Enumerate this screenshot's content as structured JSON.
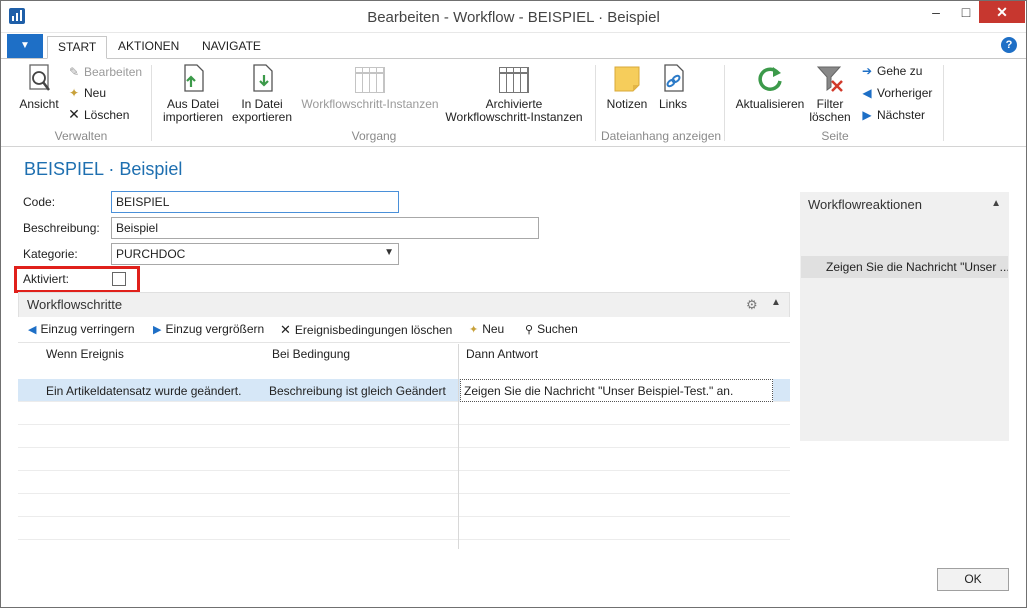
{
  "window": {
    "title": "Bearbeiten - Workflow - BEISPIEL · Beispiel",
    "minimize": "–",
    "maximize": "□",
    "close": "✕"
  },
  "tabs": [
    {
      "label": "START",
      "active": true
    },
    {
      "label": "AKTIONEN",
      "active": false
    },
    {
      "label": "NAVIGATE",
      "active": false
    }
  ],
  "ribbon": {
    "verwalten": {
      "group_label": "Verwalten",
      "ansicht": "Ansicht",
      "bearbeiten": "Bearbeiten",
      "neu": "Neu",
      "loeschen": "Löschen"
    },
    "vorgang": {
      "group_label": "Vorgang",
      "aus_datei_1": "Aus Datei",
      "aus_datei_2": "importieren",
      "in_datei_1": "In Datei",
      "in_datei_2": "exportieren",
      "instanzen": "Workflowschritt-Instanzen",
      "archiv_1": "Archivierte",
      "archiv_2": "Workflowschritt-Instanzen"
    },
    "dateianhang": {
      "group_label": "Dateianhang anzeigen",
      "notizen": "Notizen",
      "links": "Links"
    },
    "seite": {
      "group_label": "Seite",
      "aktualisieren": "Aktualisieren",
      "filter_1": "Filter",
      "filter_2": "löschen",
      "gehe_zu": "Gehe zu",
      "vorheriger": "Vorheriger",
      "naechster": "Nächster"
    }
  },
  "page": {
    "title": "BEISPIEL · Beispiel"
  },
  "fields": {
    "code": {
      "label": "Code:",
      "value": "BEISPIEL"
    },
    "beschreibung": {
      "label": "Beschreibung:",
      "value": "Beispiel"
    },
    "kategorie": {
      "label": "Kategorie:",
      "value": "PURCHDOC"
    },
    "aktiviert": {
      "label": "Aktiviert:",
      "checked": false
    }
  },
  "steps": {
    "title": "Workflowschritte",
    "actions": {
      "einzug_verringern": "Einzug verringern",
      "einzug_vergroessern": "Einzug vergrößern",
      "bedingungen_loeschen": "Ereignisbedingungen löschen",
      "neu": "Neu",
      "suchen": "Suchen"
    },
    "columns": {
      "wenn": "Wenn Ereignis",
      "bei": "Bei Bedingung",
      "dann": "Dann Antwort"
    },
    "rows": [
      {
        "wenn": "Ein Artikeldatensatz wurde geändert.",
        "bei": "Beschreibung ist gleich Geändert",
        "dann": "Zeigen Sie die Nachricht \"Unser Beispiel-Test.\" an."
      }
    ]
  },
  "factbox": {
    "title": "Workflowreaktionen",
    "item": "Zeigen Sie die Nachricht \"Unser ..."
  },
  "footer": {
    "ok": "OK"
  },
  "colors": {
    "accent": "#1e6fc6",
    "title_blue": "#1e6fb0",
    "highlight_red": "#e0201b",
    "selected_row": "#d6e7f7"
  }
}
